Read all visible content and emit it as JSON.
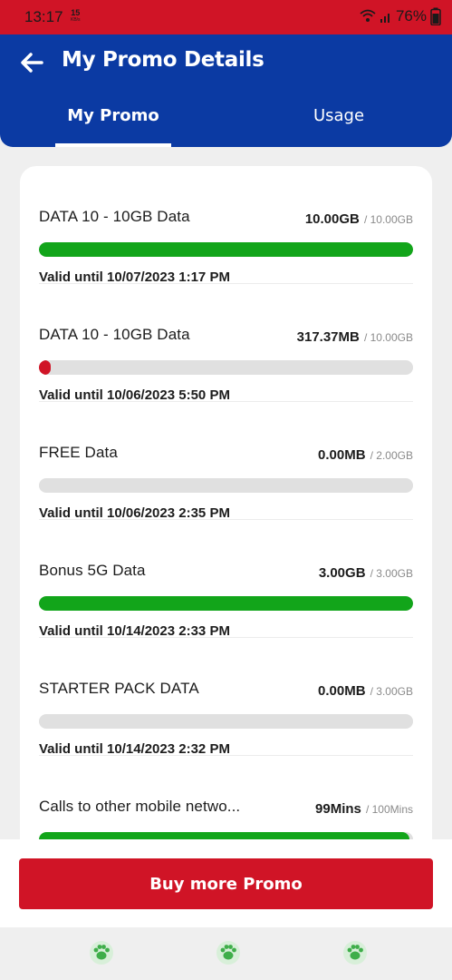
{
  "status_bar": {
    "time": "13:17",
    "speed_value": "15",
    "speed_unit": "KB/s",
    "battery": "76%"
  },
  "header": {
    "title": "My Promo Details",
    "tabs": [
      {
        "label": "My Promo",
        "active": true
      },
      {
        "label": "Usage",
        "active": false
      }
    ]
  },
  "promos": [
    {
      "name": "DATA 10 - 10GB Data",
      "used": "10.00GB",
      "total": "/ 10.00GB",
      "fraction": 1.0,
      "color": "#12a51a",
      "valid": "Valid until 10/07/2023 1:17 PM"
    },
    {
      "name": "DATA 10 - 10GB Data",
      "used": "317.37MB",
      "total": "/ 10.00GB",
      "fraction": 0.031,
      "color": "#d01426",
      "valid": "Valid until 10/06/2023 5:50 PM"
    },
    {
      "name": "FREE Data",
      "used": "0.00MB",
      "total": "/ 2.00GB",
      "fraction": 0,
      "color": "#12a51a",
      "valid": "Valid until 10/06/2023 2:35 PM"
    },
    {
      "name": "Bonus 5G Data",
      "used": "3.00GB",
      "total": "/ 3.00GB",
      "fraction": 1.0,
      "color": "#12a51a",
      "valid": "Valid until 10/14/2023 2:33 PM"
    },
    {
      "name": "STARTER PACK DATA",
      "used": "0.00MB",
      "total": "/ 3.00GB",
      "fraction": 0,
      "color": "#12a51a",
      "valid": "Valid until 10/14/2023 2:32 PM"
    },
    {
      "name": "Calls to other mobile netwo...",
      "used": "99Mins",
      "total": "/ 100Mins",
      "fraction": 0.99,
      "color": "#12a51a",
      "valid": ""
    }
  ],
  "buy_button": {
    "label": "Buy more Promo"
  },
  "colors": {
    "brand_red": "#d01426",
    "brand_blue": "#0b3aa3",
    "progress_green": "#12a51a",
    "nav_icon_green": "#3fae4a"
  },
  "nav_icons": [
    "paw-icon",
    "paw-icon",
    "paw-icon"
  ]
}
